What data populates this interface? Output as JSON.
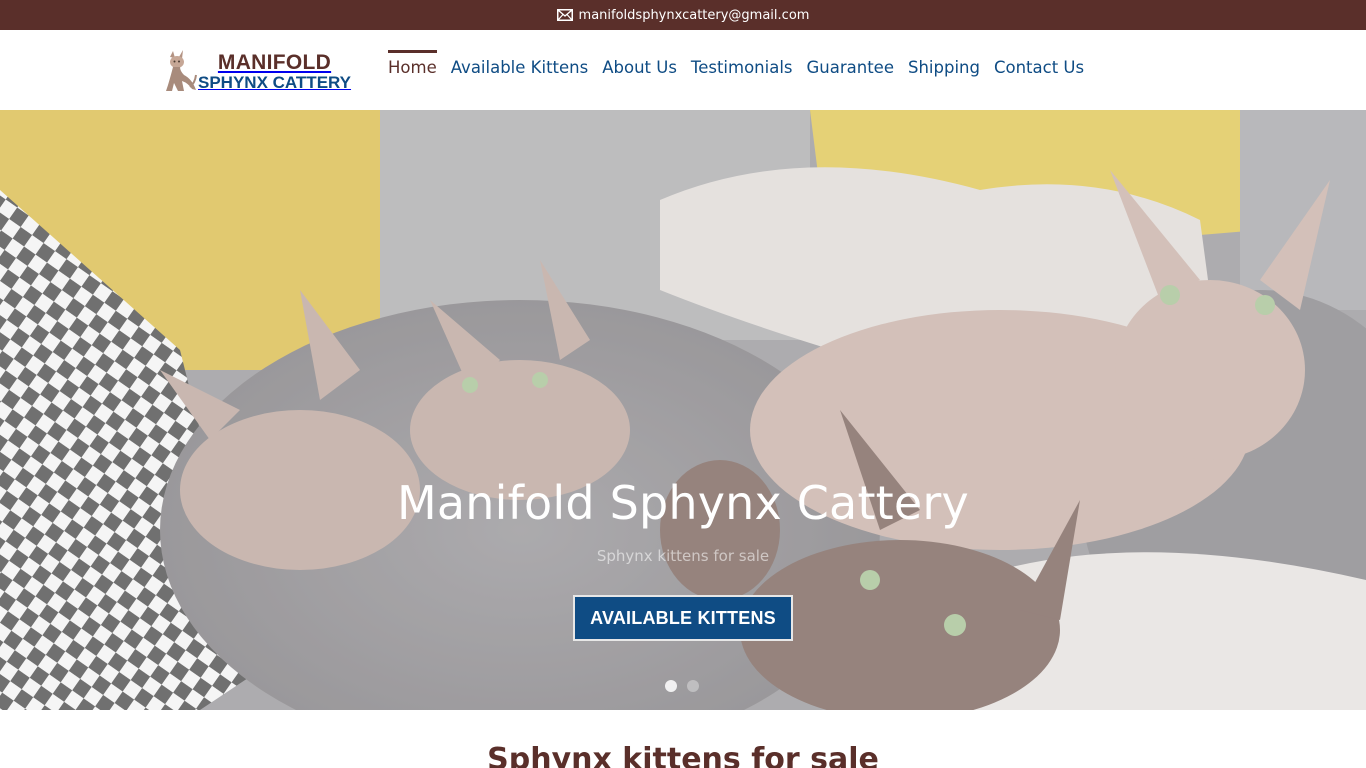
{
  "topbar": {
    "email": "manifoldsphynxcattery@gmail.com",
    "icon": "envelope-icon"
  },
  "logo": {
    "line1": "MANIFOLD",
    "line2": "SPHYNX CATTERY",
    "icon": "sphynx-cat-logo"
  },
  "nav": {
    "items": [
      {
        "label": "Home",
        "active": true
      },
      {
        "label": "Available Kittens"
      },
      {
        "label": "About Us"
      },
      {
        "label": "Testimonials"
      },
      {
        "label": "Guarantee"
      },
      {
        "label": "Shipping"
      },
      {
        "label": "Contact Us"
      }
    ]
  },
  "hero": {
    "title": "Manifold Sphynx Cattery",
    "subtitle": "Sphynx kittens for sale",
    "button": "AVAILABLE KITTENS",
    "slides": 2,
    "active_slide": 1
  },
  "section": {
    "title": "Sphynx kittens for sale"
  },
  "colors": {
    "brown": "#5a2f2a",
    "blue": "#0f4c84",
    "white": "#ffffff"
  }
}
